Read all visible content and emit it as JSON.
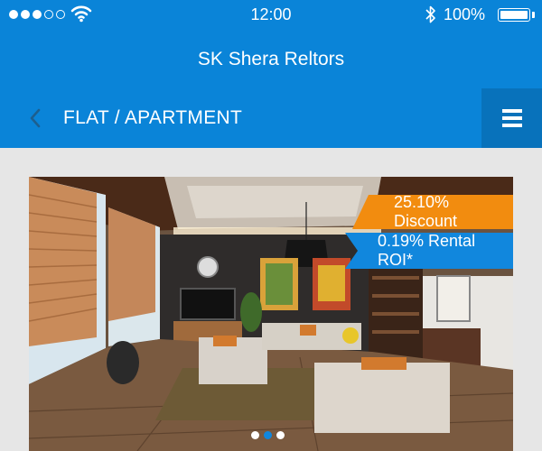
{
  "status_bar": {
    "time": "12:00",
    "battery": "100%",
    "signal_dots": 5,
    "signal_filled": 3
  },
  "header": {
    "title": "SK Shera Reltors"
  },
  "sub_header": {
    "title": "FLAT / APARTMENT"
  },
  "card": {
    "discount_label": "25.10% Discount",
    "roi_label": "0.19% Rental ROI*",
    "carousel": {
      "pages": 3,
      "active": 2
    }
  },
  "colors": {
    "primary": "#0a84d8",
    "menu_bg": "#0872bb",
    "discount": "#f28c0f",
    "roi": "#1187dd"
  },
  "icons": {
    "back": "chevron-left-icon",
    "menu": "hamburger-menu-icon",
    "wifi": "wifi-icon",
    "bluetooth": "bluetooth-icon",
    "battery": "battery-icon"
  }
}
